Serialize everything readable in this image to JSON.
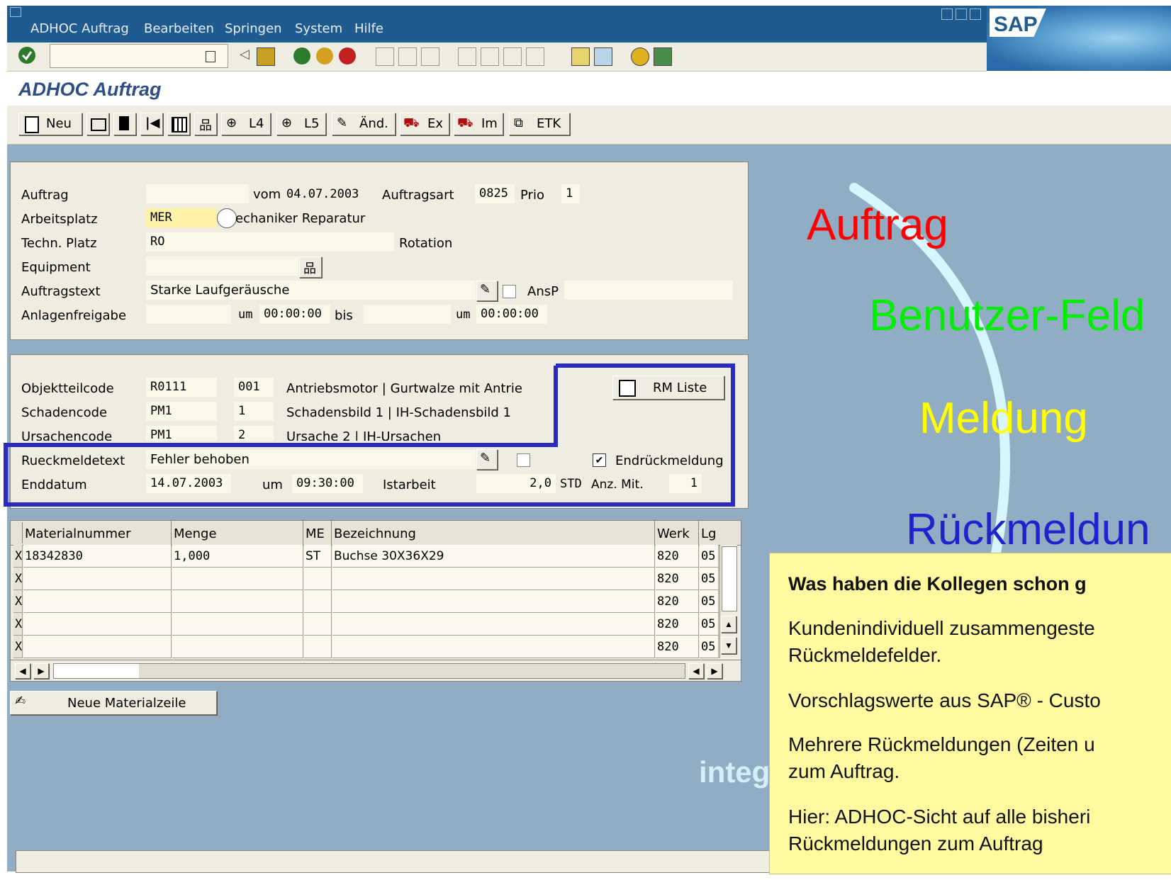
{
  "menu": {
    "items": [
      "ADHOC Auftrag",
      "Bearbeiten",
      "Springen",
      "System",
      "Hilfe"
    ]
  },
  "screen_title": "ADHOC Auftrag",
  "app_toolbar": {
    "neu": "Neu",
    "l4": "L4",
    "l5": "L5",
    "aend": "Änd.",
    "ex": "Ex",
    "im": "Im",
    "etk": "ETK"
  },
  "header": {
    "auftrag_label": "Auftrag",
    "vom_label": "vom",
    "vom_date": "04.07.2003",
    "auftragsart_label": "Auftragsart",
    "auftragsart_value": "0825",
    "prio_label": "Prio",
    "prio_value": "1",
    "arbeitsplatz_label": "Arbeitsplatz",
    "arbeitsplatz_value": "MER",
    "arbeitsplatz_text": "echaniker Reparatur",
    "techn_platz_label": "Techn. Platz",
    "techn_platz_value": "RO",
    "techn_platz_text": "Rotation",
    "equipment_label": "Equipment",
    "auftragstext_label": "Auftragstext",
    "auftragstext_value": "Starke Laufgeräusche",
    "ansp_label": "AnsP",
    "anlagenfreigabe_label": "Anlagenfreigabe",
    "um_label": "um",
    "time1": "00:00:00",
    "bis_label": "bis",
    "um2_label": "um",
    "time2": "00:00:00"
  },
  "codes": {
    "objektteilcode_label": "Objektteilcode",
    "objektteilcode_value": "R0111",
    "objektteilcode_num": "001",
    "objektteilcode_text": "Antriebsmotor | Gurtwalze mit Antrie",
    "schadencode_label": "Schadencode",
    "schadencode_value": "PM1",
    "schadencode_num": "1",
    "schadencode_text": "Schadensbild 1 | IH-Schadensbild 1",
    "ursachencode_label": "Ursachencode",
    "ursachencode_value": "PM1",
    "ursachencode_num": "2",
    "ursachencode_text": "Ursache 2 | IH-Ursachen",
    "rm_liste": "RM Liste",
    "rueckmeldetext_label": "Rueckmeldetext",
    "rueckmeldetext_value": "Fehler behoben",
    "endrueck_label": "Endrückmeldung",
    "enddatum_label": "Enddatum",
    "enddatum_value": "14.07.2003",
    "um_label": "um",
    "endzeit": "09:30:00",
    "istarbeit_label": "Istarbeit",
    "istarbeit_value": "2,0",
    "std": "STD",
    "anz_label": "Anz. Mit.",
    "anz_value": "1"
  },
  "material_table": {
    "columns": [
      "Materialnummer",
      "Menge",
      "ME",
      "Bezeichnung",
      "Werk",
      "Lg"
    ],
    "rows": [
      {
        "mark": "X",
        "matnr": "18342830",
        "menge": "1,000",
        "me": "ST",
        "bez": "Buchse 30X36X29",
        "werk": "820",
        "lg": "05"
      },
      {
        "mark": "X",
        "matnr": "",
        "menge": "",
        "me": "",
        "bez": "",
        "werk": "820",
        "lg": "05"
      },
      {
        "mark": "X",
        "matnr": "",
        "menge": "",
        "me": "",
        "bez": "",
        "werk": "820",
        "lg": "05"
      },
      {
        "mark": "X",
        "matnr": "",
        "menge": "",
        "me": "",
        "bez": "",
        "werk": "820",
        "lg": "05"
      },
      {
        "mark": "X",
        "matnr": "",
        "menge": "",
        "me": "",
        "bez": "",
        "werk": "820",
        "lg": "05"
      }
    ]
  },
  "neue_materialzeile": "Neue Materialzeile",
  "overlay": {
    "auftrag": "Auftrag",
    "benutzer": "Benutzer-Feld",
    "meldung": "Meldung",
    "rueckmeldung": "Rückmeldun",
    "integ": "integ"
  },
  "callout": {
    "heading": "Was haben die Kollegen schon g",
    "p1a": "Kundenindividuell zusammengeste",
    "p1b": "Rückmeldefelder.",
    "p2": "Vorschlagswerte aus SAP® - Custo",
    "p3a": "Mehrere Rückmeldungen (Zeiten u",
    "p3b": "zum Auftrag.",
    "p4a": "Hier: ADHOC-Sicht auf alle bisheri",
    "p4b": "Rückmeldungen zum Auftrag"
  },
  "colors": {
    "menubar": "#1f5b8f",
    "workarea": "#91adc3",
    "panel": "#efece1",
    "field": "#fbf8e9",
    "callout": "#fffaa0",
    "highlight": "#2b2bc0"
  }
}
